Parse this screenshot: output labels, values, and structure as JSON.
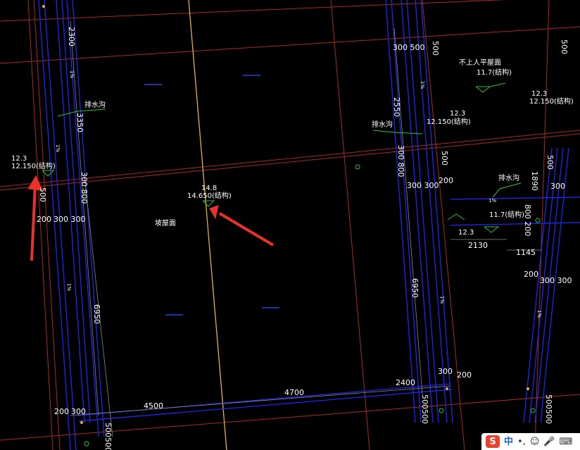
{
  "drawing": {
    "roof_main_label": "坡屋面",
    "roof_flat_label": "不上人平屋面",
    "drain_label": "排水沟",
    "slope_mark": "1%",
    "elev_1_top": "12.3",
    "elev_1_bottom": "12.150(结构)",
    "elev_2_top": "14.8",
    "elev_2_bottom": "14.650(结构)",
    "elev_3_top": "12.3",
    "elev_3_bottom": "12.150(结构)",
    "elev_4_top": "12.3",
    "elev_4_bottom": "12.150(结构)",
    "elev_5": "11.7(结构)",
    "elev_6": "11.7(结构)",
    "elev_7": "12.3",
    "dims": {
      "d2300": "2300",
      "d3350": "3350",
      "d300_800_left": "300 800",
      "d500_left": "500",
      "d200_left": "200",
      "d300_300_left": "300 300",
      "d6950_left": "6950",
      "d200_bottom_left": "200",
      "d300_bottom_left": "300",
      "d4500": "4500",
      "d4700": "4700",
      "d2400": "2400",
      "d500_500_bottom": "500500",
      "d300_500_top": "300 500",
      "d500_top_r": "500",
      "d2550": "2550",
      "d300_800_mid": "300 800",
      "d500_mid": "500",
      "d300_300_mid": "300 300",
      "d200_mid": "200",
      "d6950_right": "6950",
      "d300_r_bottom": "300",
      "d200_r_bottom": "200",
      "d500500_r_bottom": "500500",
      "d2130": "2130",
      "d1145": "1145",
      "d800_200": "800 200",
      "d1890": "1890",
      "d500_far": "500",
      "d300_far": "300",
      "d200_far": "200",
      "d300_300_far": "300 300",
      "d500500_far": "500500",
      "d500_corner": "500"
    }
  },
  "ime": {
    "logo": "S",
    "lang": "中",
    "punct": "•,",
    "emoji": "☺",
    "mic": "🎤",
    "kbd": "⌨"
  },
  "colors": {
    "background": "#000000",
    "wall": "#1e2bff",
    "axis": "#c0392b",
    "dim": "#ffffff",
    "annot": "#27c43a",
    "roof_line": "#f0c040",
    "arrow": "#e8322a"
  }
}
